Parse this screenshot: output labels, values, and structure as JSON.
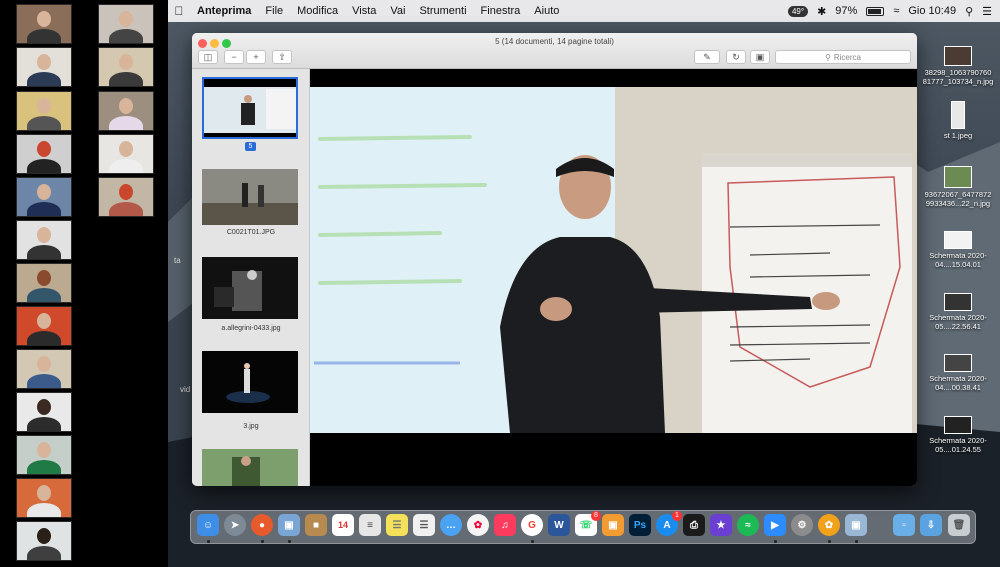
{
  "menubar": {
    "apple_icon": "apple-icon",
    "app_name": "Anteprima",
    "items": [
      "File",
      "Modifica",
      "Vista",
      "Vai",
      "Strumenti",
      "Finestra",
      "Aiuto"
    ],
    "temperature": "49°",
    "battery": "97%",
    "clock": "Gio 10:49"
  },
  "window": {
    "title": "5 (14 documenti, 14 pagine totali)",
    "search_placeholder": "Ricerca",
    "sidebar": {
      "current_page": "5",
      "thumbnails": [
        {
          "label": "",
          "selected": true
        },
        {
          "label": "C0021T01.JPG"
        },
        {
          "label": "a.allegrini-0433.jpg"
        },
        {
          "label": "3.jpg"
        },
        {
          "label": ""
        }
      ]
    }
  },
  "desktop_files": [
    {
      "label": "38298_1063790760 81777_103734_n.jpg"
    },
    {
      "label": "st 1.jpeg"
    },
    {
      "label": "93672067_6477872 9933436...22_n.jpg"
    },
    {
      "label": "Schermata 2020-04....15.04.01"
    },
    {
      "label": "Schermata 2020-05....22.56.41"
    },
    {
      "label": "Schermata 2020-04....00.38.41"
    },
    {
      "label": "Schermata 2020-05....01.24.55"
    }
  ],
  "overlay_fragments": [
    "ta",
    "vid"
  ],
  "dock": {
    "calendar_day": "14",
    "mail_badge": "8",
    "appstore_badge": "1",
    "ps_label": "Ps"
  },
  "colors": {
    "menubar": "#e8e8ea",
    "selection": "#2b6ad9",
    "accent_zoom": "#2d8cff"
  }
}
